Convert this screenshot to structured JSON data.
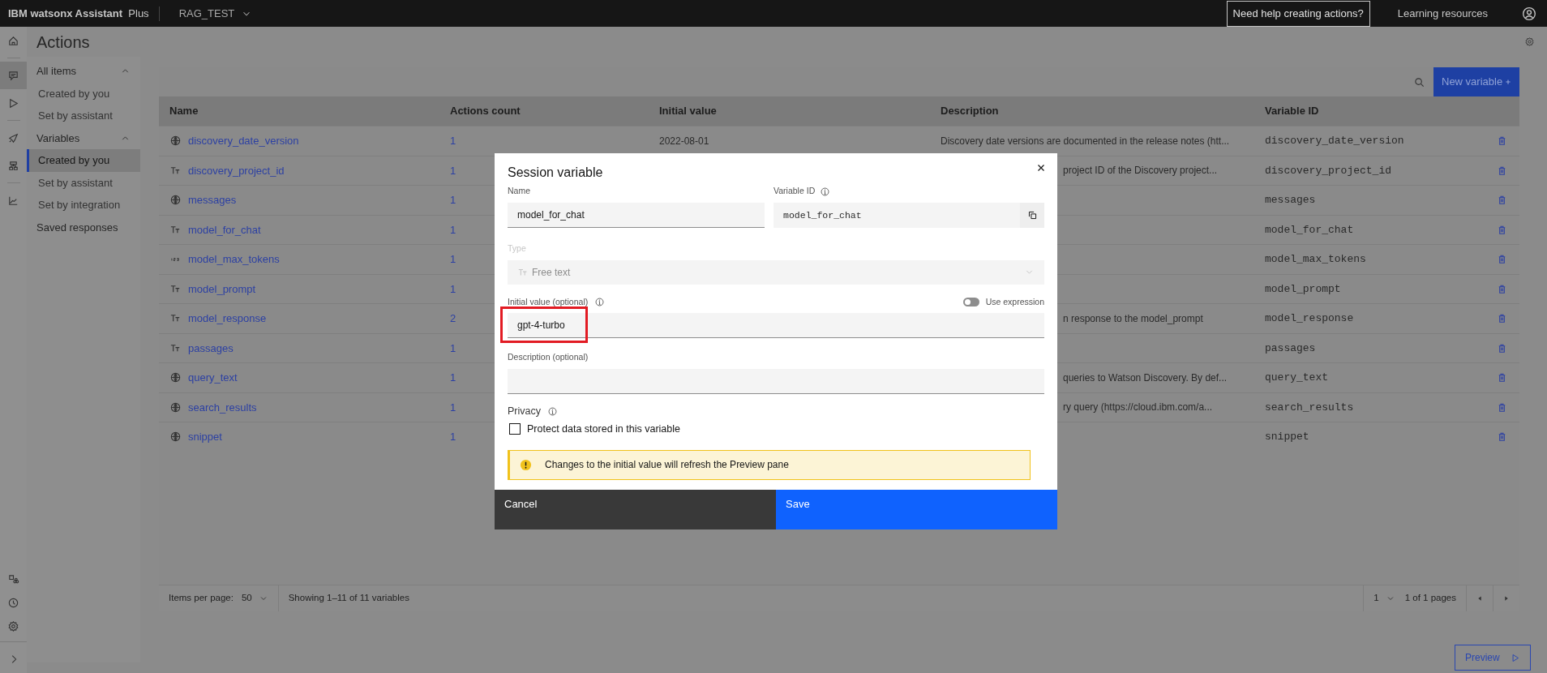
{
  "top_bar": {
    "brand": "IBM watsonx Assistant",
    "plan": "Plus",
    "assistant": "RAG_TEST",
    "help_button": "Need help creating actions?",
    "resources": "Learning resources"
  },
  "rail": [
    {
      "kind": "home",
      "selected": false
    },
    {
      "kind": "chat",
      "selected": true
    },
    {
      "kind": "play",
      "selected": false
    },
    {
      "kind": "rocket",
      "selected": false
    },
    {
      "kind": "flow",
      "selected": false
    },
    {
      "kind": "chart",
      "selected": false
    }
  ],
  "rail_bottom": [
    {
      "kind": "integrations"
    },
    {
      "kind": "history"
    },
    {
      "kind": "settings"
    }
  ],
  "page_title": "Actions",
  "nav": [
    {
      "label": "All items",
      "expanded": true,
      "items": [
        {
          "label": "Created by you",
          "selected": false
        },
        {
          "label": "Set by assistant",
          "selected": false
        }
      ]
    },
    {
      "label": "Variables",
      "expanded": true,
      "items": [
        {
          "label": "Created by you",
          "selected": true
        },
        {
          "label": "Set by assistant",
          "selected": false
        },
        {
          "label": "Set by integration",
          "selected": false
        }
      ]
    },
    {
      "label": "Saved responses"
    }
  ],
  "toolbar": {
    "new_button": "New variable"
  },
  "table": {
    "columns": [
      "Name",
      "Actions count",
      "Initial value",
      "Description",
      "Variable ID"
    ],
    "rows": [
      {
        "kind": "globe",
        "name": "discovery_date_version",
        "actions_count": "1",
        "initial_value": "2022-08-01",
        "description": "Discovery date versions are documented in the release notes (htt...",
        "covered": false,
        "variable_id": "discovery_date_version"
      },
      {
        "kind": "text",
        "name": "discovery_project_id",
        "actions_count": "1",
        "description": "project ID of the Discovery project...",
        "covered": true,
        "variable_id": "discovery_project_id"
      },
      {
        "kind": "globe",
        "name": "messages",
        "actions_count": "1",
        "variable_id": "messages"
      },
      {
        "kind": "text",
        "name": "model_for_chat",
        "actions_count": "1",
        "variable_id": "model_for_chat"
      },
      {
        "kind": "number",
        "name": "model_max_tokens",
        "actions_count": "1",
        "variable_id": "model_max_tokens"
      },
      {
        "kind": "text",
        "name": "model_prompt",
        "actions_count": "1",
        "variable_id": "model_prompt"
      },
      {
        "kind": "text",
        "name": "model_response",
        "actions_count": "2",
        "description": "n response to the model_prompt",
        "covered": true,
        "variable_id": "model_response"
      },
      {
        "kind": "text",
        "name": "passages",
        "actions_count": "1",
        "variable_id": "passages"
      },
      {
        "kind": "globe",
        "name": "query_text",
        "actions_count": "1",
        "description": "queries to Watson Discovery. By def...",
        "covered": true,
        "variable_id": "query_text"
      },
      {
        "kind": "globe",
        "name": "search_results",
        "actions_count": "1",
        "description": "ry query (https://cloud.ibm.com/a...",
        "covered": true,
        "variable_id": "search_results"
      },
      {
        "kind": "globe",
        "name": "snippet",
        "actions_count": "1",
        "variable_id": "snippet"
      }
    ]
  },
  "pagination": {
    "items_per_page_label": "Items per page:",
    "items_per_page": "50",
    "summary": "Showing 1–11 of 11 variables",
    "page": "1",
    "pages_label": "1 of 1 pages"
  },
  "preview_button": "Preview",
  "dialog": {
    "title": "Session variable",
    "name": {
      "label": "Name",
      "value": "model_for_chat"
    },
    "variable_id": {
      "label": "Variable ID",
      "value": "model_for_chat"
    },
    "type": {
      "label": "Type",
      "value": "Free text",
      "disabled": true
    },
    "initial_value": {
      "label": "Initial value (optional)",
      "value": "gpt-4-turbo",
      "highlighted": true
    },
    "use_expression": {
      "label": "Use expression",
      "on": false
    },
    "description": {
      "label": "Description (optional)"
    },
    "privacy": {
      "label": "Privacy",
      "checkbox": "Protect data stored in this variable",
      "checked": false
    },
    "notice": "Changes to the initial value will refresh the Preview pane",
    "buttons": [
      {
        "label": "Cancel",
        "kind": "secondary"
      },
      {
        "label": "Save",
        "kind": "primary"
      }
    ]
  }
}
